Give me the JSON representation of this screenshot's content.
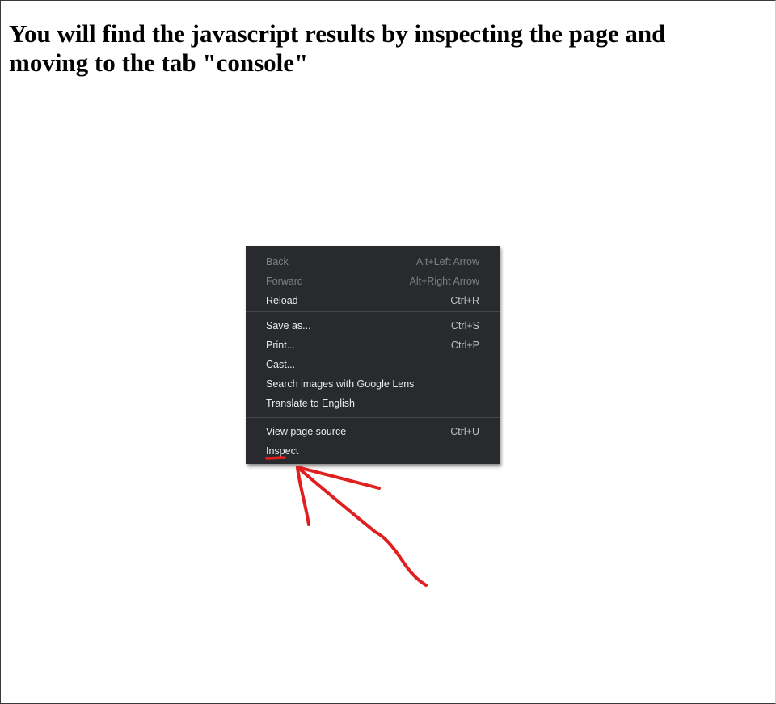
{
  "page": {
    "heading": "You will find the javascript results by inspecting the page and moving to the tab \"console\""
  },
  "context_menu": {
    "items": [
      {
        "label": "Back",
        "shortcut": "Alt+Left Arrow",
        "disabled": true
      },
      {
        "label": "Forward",
        "shortcut": "Alt+Right Arrow",
        "disabled": true
      },
      {
        "label": "Reload",
        "shortcut": "Ctrl+R",
        "disabled": false
      },
      {
        "label": "Save as...",
        "shortcut": "Ctrl+S",
        "disabled": false
      },
      {
        "label": "Print...",
        "shortcut": "Ctrl+P",
        "disabled": false
      },
      {
        "label": "Cast...",
        "shortcut": "",
        "disabled": false
      },
      {
        "label": "Search images with Google Lens",
        "shortcut": "",
        "disabled": false
      },
      {
        "label": "Translate to English",
        "shortcut": "",
        "disabled": false
      },
      {
        "label": "View page source",
        "shortcut": "Ctrl+U",
        "disabled": false
      },
      {
        "label": "Inspect",
        "shortcut": "",
        "disabled": false
      }
    ]
  },
  "colors": {
    "menu_background": "#292a2d",
    "menu_text": "#e8eaed",
    "menu_disabled_text": "#7d7f83",
    "annotation": "#e02020"
  },
  "annotation": {
    "icon": "hand-drawn-arrow-icon",
    "target": "Inspect"
  }
}
